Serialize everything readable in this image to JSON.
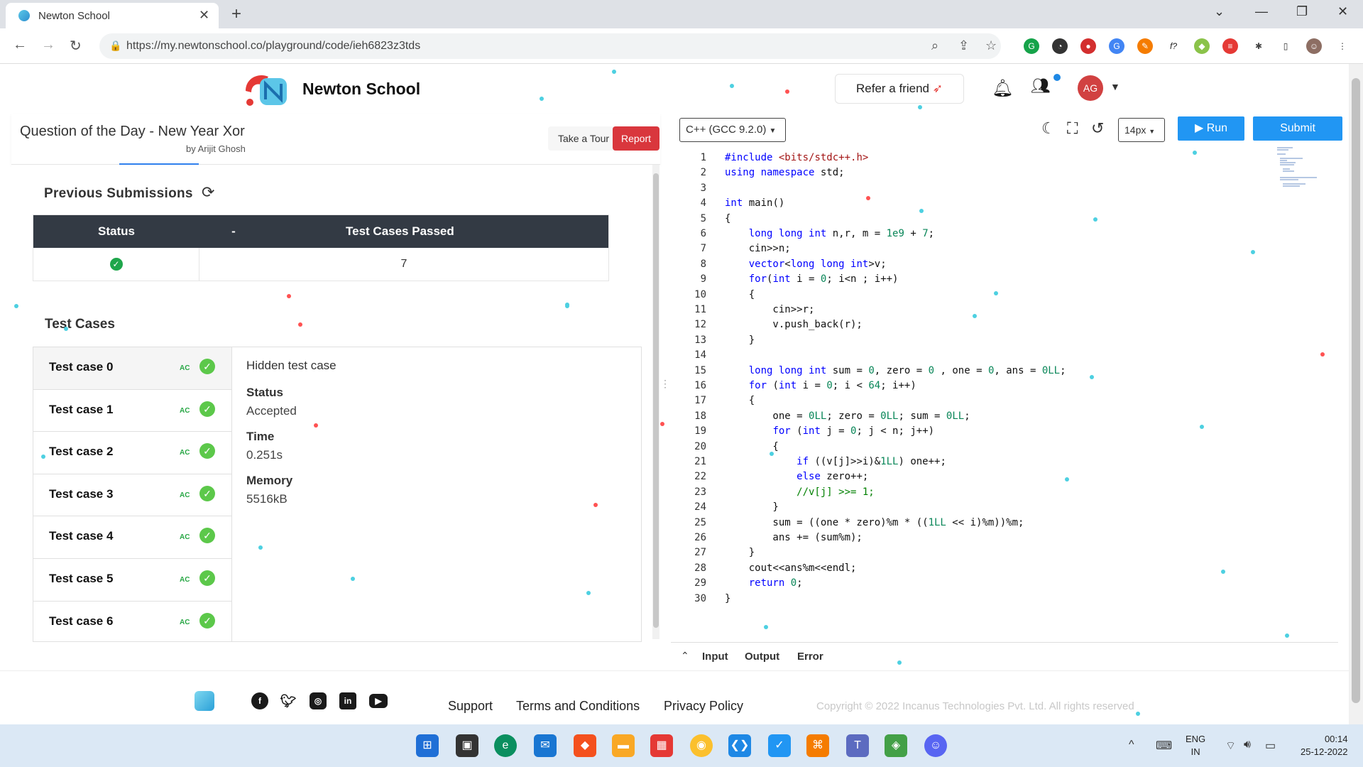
{
  "browser": {
    "tab_title": "Newton School",
    "url": "https://my.newtonschool.co/playground/code/ieh6823z3tds"
  },
  "header": {
    "brand": "Newton School",
    "refer_label": "Refer a friend",
    "avatar_initials": "AG"
  },
  "question": {
    "title": "Question of the Day - New Year Xor",
    "author": "by Arijit Ghosh",
    "tour_label": "Take a Tour",
    "report_label": "Report"
  },
  "submissions": {
    "title": "Previous Submissions",
    "columns": [
      "Status",
      "-",
      "Test Cases Passed"
    ],
    "rows": [
      {
        "passed": "7"
      }
    ]
  },
  "test_cases": {
    "title": "Test Cases",
    "items": [
      {
        "label": "Test case 0",
        "badge": "AC"
      },
      {
        "label": "Test case 1",
        "badge": "AC"
      },
      {
        "label": "Test case 2",
        "badge": "AC"
      },
      {
        "label": "Test case 3",
        "badge": "AC"
      },
      {
        "label": "Test case 4",
        "badge": "AC"
      },
      {
        "label": "Test case 5",
        "badge": "AC"
      },
      {
        "label": "Test case 6",
        "badge": "AC"
      }
    ],
    "detail": {
      "heading": "Hidden test case",
      "status_label": "Status",
      "status_value": "Accepted",
      "time_label": "Time",
      "time_value": "0.251s",
      "memory_label": "Memory",
      "memory_value": "5516kB"
    }
  },
  "editor": {
    "language": "C++ (GCC 9.2.0)",
    "font_size": "14px",
    "run_label": "Run",
    "submit_label": "Submit",
    "code": [
      "#include <bits/stdc++.h>",
      "using namespace std;",
      "",
      "int main()",
      "{",
      "    long long int n,r, m = 1e9 + 7;",
      "    cin>>n;",
      "    vector<long long int>v;",
      "    for(int i = 0; i<n ; i++)",
      "    {",
      "        cin>>r;",
      "        v.push_back(r);",
      "    }",
      "",
      "    long long int sum = 0, zero = 0 , one = 0, ans = 0LL;",
      "    for (int i = 0; i < 64; i++)",
      "    {",
      "        one = 0LL; zero = 0LL; sum = 0LL;",
      "        for (int j = 0; j < n; j++)",
      "        {",
      "            if ((v[j]>>i)&1LL) one++;",
      "            else zero++;",
      "            //v[j] >>= 1;",
      "        }",
      "        sum = ((one * zero)%m * ((1LL << i)%m))%m;",
      "        ans += (sum%m);",
      "    }",
      "    cout<<ans%m<<endl;",
      "    return 0;",
      "}"
    ]
  },
  "io_tabs": [
    "Input",
    "Output",
    "Error"
  ],
  "footer": {
    "links": [
      "Support",
      "Terms and Conditions",
      "Privacy Policy"
    ],
    "copyright": "Copyright © 2022 Incanus Technologies Pvt. Ltd. All rights reserved"
  },
  "system": {
    "lang_line1": "ENG",
    "lang_line2": "IN",
    "time": "00:14",
    "date": "25-12-2022"
  },
  "colors": {
    "accent": "#2196f3",
    "report": "#d9373d",
    "table_header": "#333a44",
    "success": "#28a745"
  }
}
